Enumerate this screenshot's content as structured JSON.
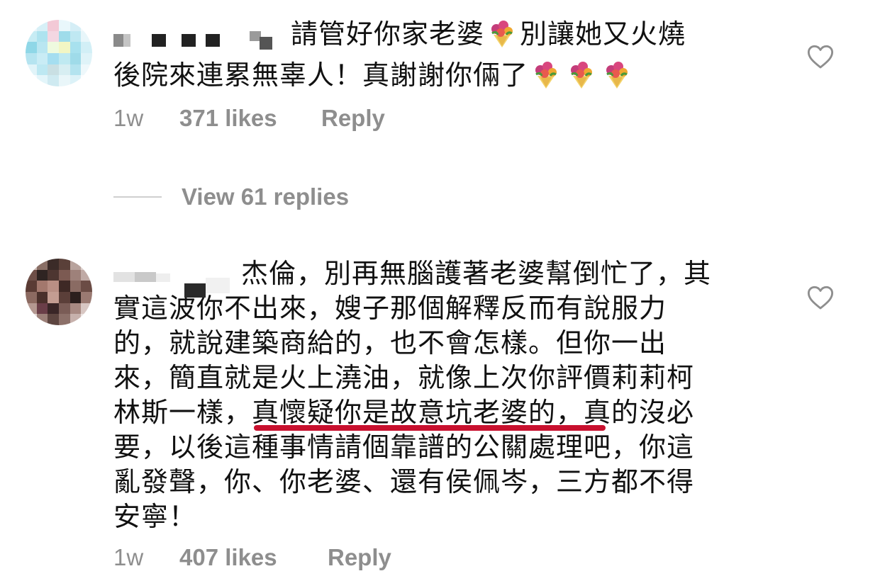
{
  "comments": [
    {
      "text_line1": "請管好你家老婆",
      "text_line1b": "別讓她又火燒",
      "text_line2": "後院來連累無辜人！真謝謝你倆了",
      "age": "1w",
      "likes": "371 likes",
      "reply": "Reply",
      "view_replies": "View 61 replies"
    },
    {
      "text_line1": "杰倫，別再無腦護著老婆幫倒忙了，其",
      "text_line2": "實這波你不出來，嫂子那個解釋反而有說服力",
      "text_line3": "的，就說建築商給的，也不會怎樣。但你一出",
      "text_line4": "來，簡直就是火上澆油，就像上次你評價莉莉柯",
      "text_line5a": "林斯一樣，",
      "text_line5b": "真懷疑你是故意坑老婆的",
      "text_line5c": "，真的沒必",
      "text_line6": "要，以後這種事情請個靠譜的公關處理吧，你這",
      "text_line7": "亂發聲，你、你老婆、還有侯佩岑，三方都不得",
      "text_line8": "安寧！",
      "age": "1w",
      "likes": "407 likes",
      "reply": "Reply"
    }
  ],
  "icons": {
    "like": "heart-outline-icon",
    "emoji": "bouquet-emoji"
  },
  "colors": {
    "meta_gray": "#8e8e8e",
    "underline": "#c8102e"
  }
}
